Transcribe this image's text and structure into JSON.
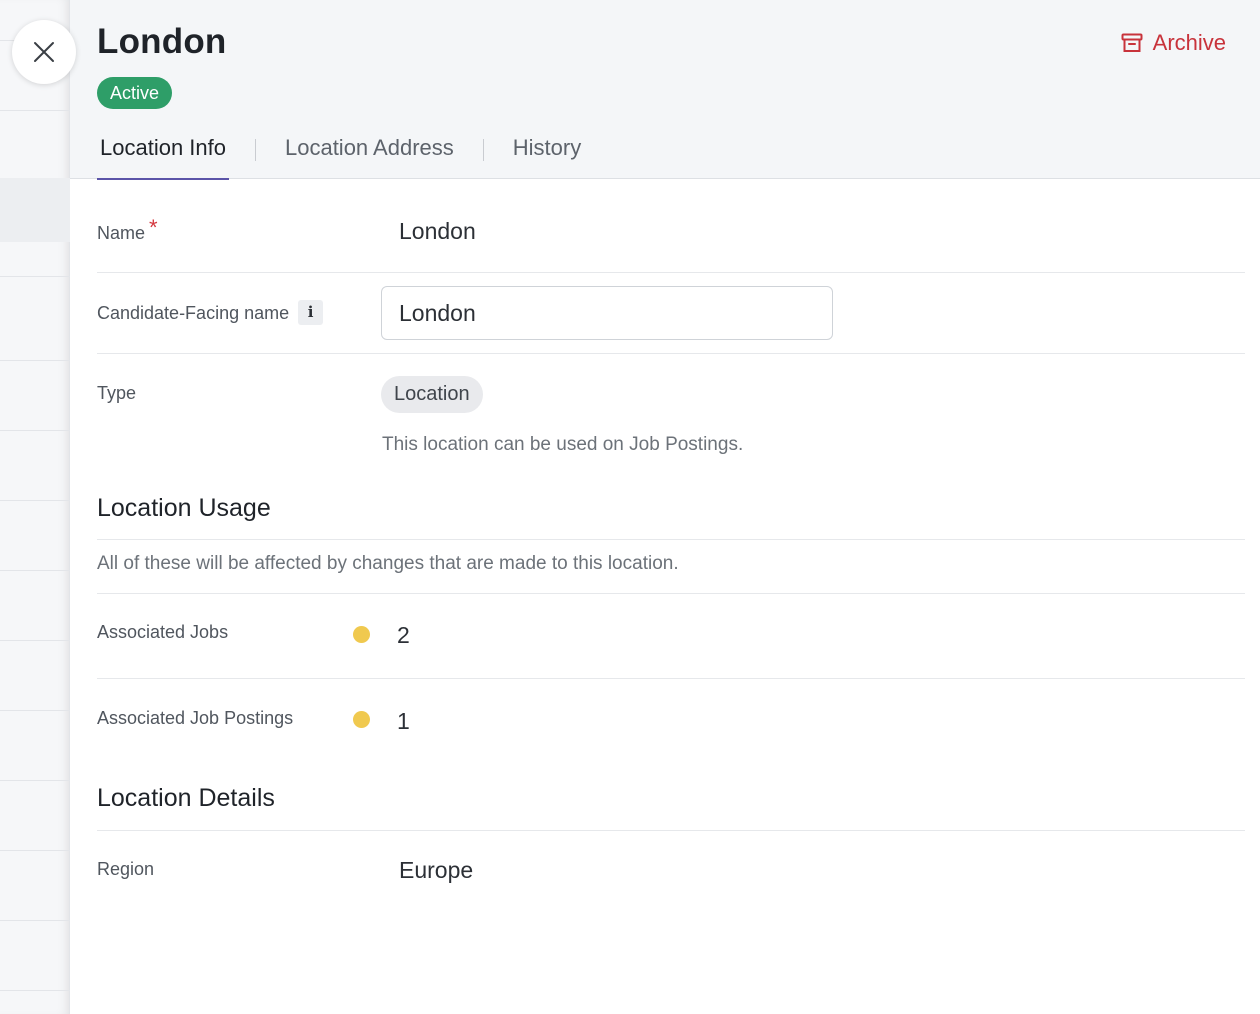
{
  "drawer": {
    "title": "London",
    "status_badge": "Active",
    "archive_label": "Archive",
    "close_icon": "close-icon",
    "archive_icon": "archive-box-icon"
  },
  "tabs": [
    {
      "label": "Location Info",
      "active": true
    },
    {
      "label": "Location Address",
      "active": false
    },
    {
      "label": "History",
      "active": false
    }
  ],
  "fields": {
    "name": {
      "label": "Name",
      "required_marker": "*",
      "value": "London"
    },
    "candidate_facing_name": {
      "label": "Candidate-Facing name",
      "info_glyph": "i",
      "value": "London"
    },
    "type": {
      "label": "Type",
      "chip": "Location",
      "helper": "This location can be used on Job Postings."
    }
  },
  "location_usage": {
    "title": "Location Usage",
    "description": "All of these will be affected by changes that are made to this location.",
    "associated_jobs": {
      "label": "Associated Jobs",
      "count": "2"
    },
    "associated_job_postings": {
      "label": "Associated Job Postings",
      "count": "1"
    },
    "dot_color": "#f0c94f"
  },
  "location_details": {
    "title": "Location Details",
    "region": {
      "label": "Region",
      "value": "Europe"
    }
  },
  "colors": {
    "accent": "#5b54a8",
    "active_badge": "#2e9e68",
    "archive": "#c8333b",
    "required": "#d4383f"
  }
}
